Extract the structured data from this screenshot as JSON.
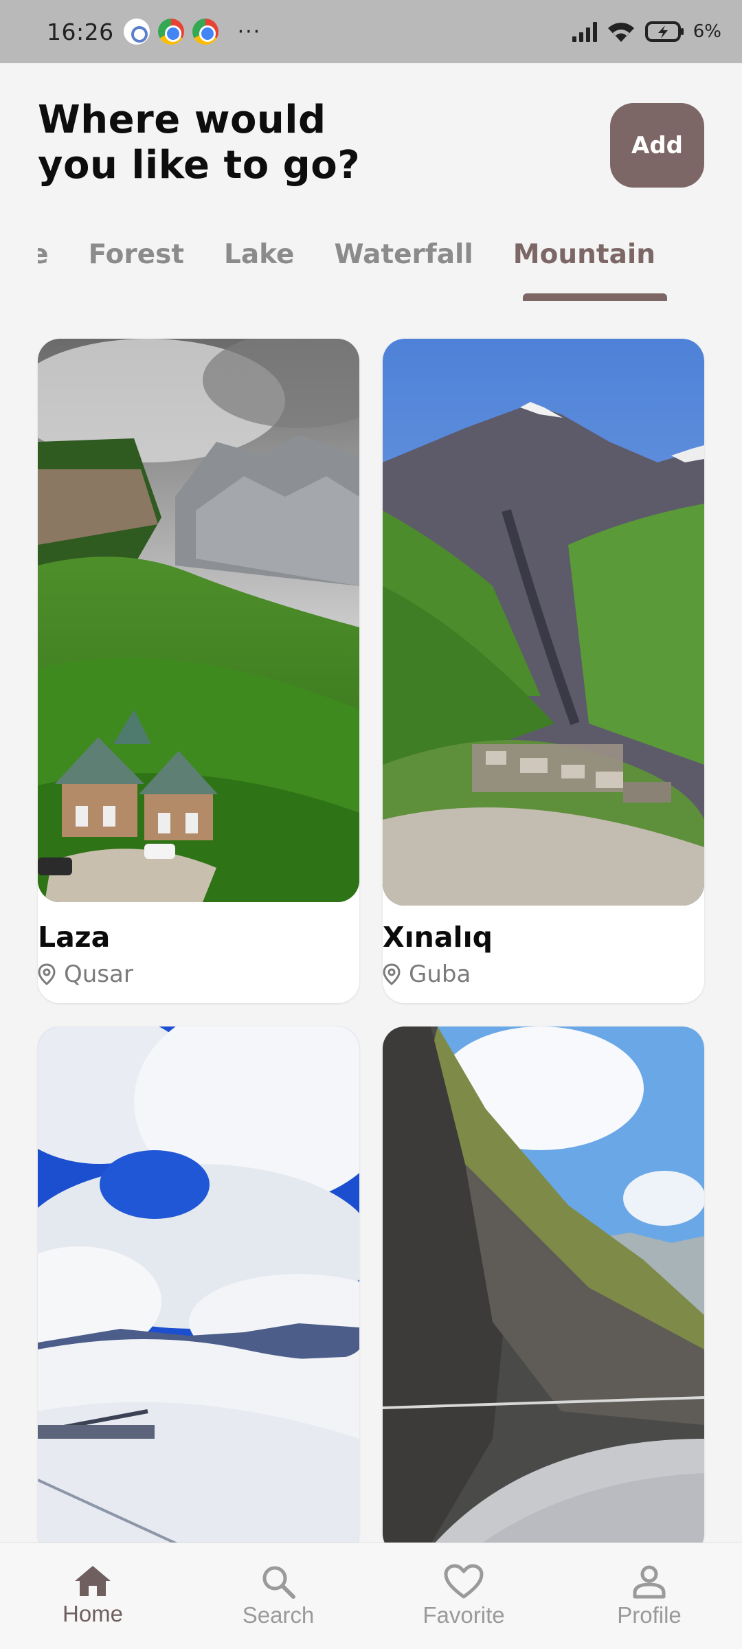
{
  "status_bar": {
    "time": "16:26",
    "more": "···",
    "battery": "6%",
    "icons": [
      "settings-app-icon",
      "chrome-icon",
      "chrome-icon",
      "signal-icon",
      "wifi-icon",
      "battery-charging-icon"
    ]
  },
  "header": {
    "title_line1": "Where would",
    "title_line2": "you like to go?",
    "add_label": "Add"
  },
  "tabs": {
    "items": [
      "ce",
      "Forest",
      "Lake",
      "Waterfall",
      "Mountain"
    ],
    "active": "Mountain"
  },
  "places": [
    {
      "name": "Laza",
      "location": "Qusar"
    },
    {
      "name": "Xınalıq",
      "location": "Guba"
    },
    {
      "name": "",
      "location": ""
    },
    {
      "name": "",
      "location": ""
    }
  ],
  "nav": {
    "items": [
      {
        "label": "Home",
        "icon": "home-icon",
        "active": true
      },
      {
        "label": "Search",
        "icon": "search-icon",
        "active": false
      },
      {
        "label": "Favorite",
        "icon": "heart-icon",
        "active": false
      },
      {
        "label": "Profile",
        "icon": "profile-icon",
        "active": false
      }
    ]
  },
  "colors": {
    "accent": "#7c6766",
    "background": "#f4f4f4",
    "inactive_text": "#8b8b8b"
  }
}
